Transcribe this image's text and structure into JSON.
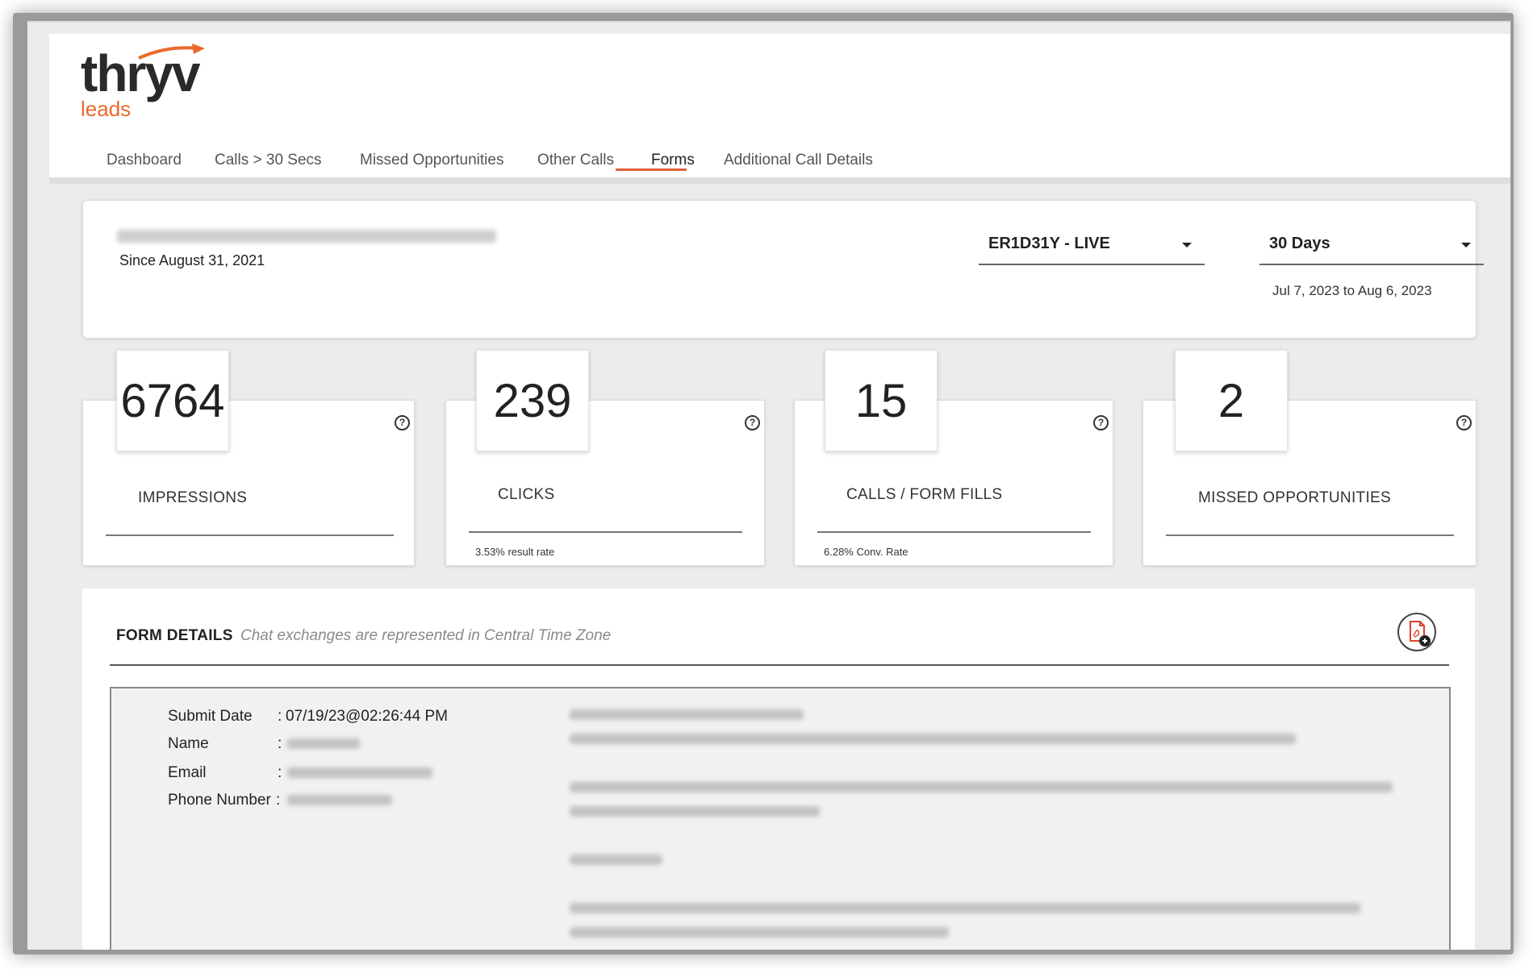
{
  "app": {
    "logo_text": "thryv",
    "logo_sub": "leads",
    "brand_color": "#ea6a2d"
  },
  "nav": {
    "items": [
      {
        "label": "Dashboard"
      },
      {
        "label": "Calls > 30 Secs"
      },
      {
        "label": "Missed Opportunities"
      },
      {
        "label": "Other Calls"
      },
      {
        "label": "Forms",
        "active": true
      },
      {
        "label": "Additional Call Details"
      }
    ]
  },
  "account": {
    "since": "Since August 31, 2021",
    "campaign_select": "ER1D31Y - LIVE",
    "period_select": "30 Days",
    "date_range": "Jul 7, 2023 to Aug 6, 2023"
  },
  "stats": [
    {
      "value": "6764",
      "label": "IMPRESSIONS",
      "sub": ""
    },
    {
      "value": "239",
      "label": "CLICKS",
      "sub": "3.53% result rate"
    },
    {
      "value": "15",
      "label": "CALLS / FORM FILLS",
      "sub": "6.28% Conv. Rate"
    },
    {
      "value": "2",
      "label": "MISSED OPPORTUNITIES",
      "sub": ""
    }
  ],
  "help_icon": "question-circle-icon",
  "form_details": {
    "title": "FORM DETAILS",
    "note": "Chat exchanges are represented in Central Time Zone",
    "pdf_icon": "pdf-download-icon",
    "fields": [
      {
        "label": "Submit Date",
        "colon": ":",
        "value": "07/19/23@02:26:44 PM"
      },
      {
        "label": "Name",
        "colon": ":",
        "value": ""
      },
      {
        "label": "Email",
        "colon": ":",
        "value": ""
      },
      {
        "label": "Phone Number",
        "colon": ":",
        "value": ""
      }
    ]
  }
}
